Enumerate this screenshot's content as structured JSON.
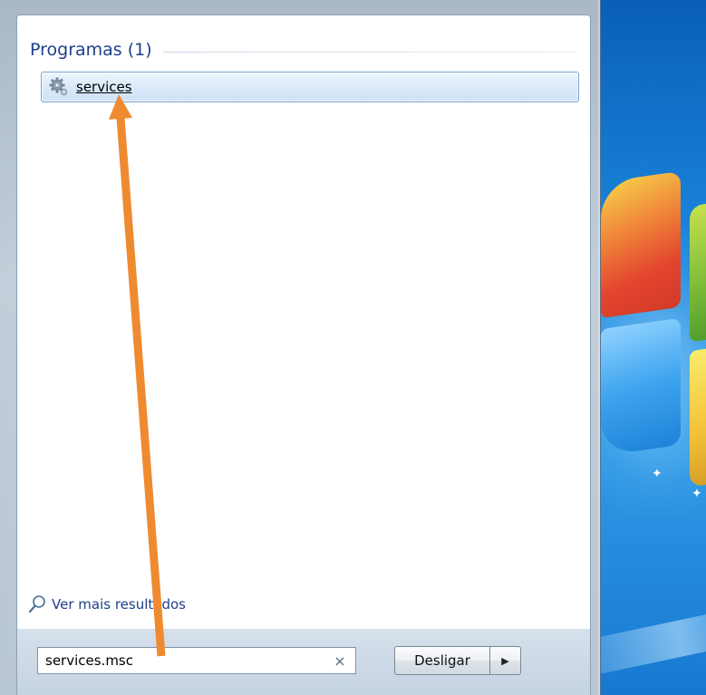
{
  "start_menu": {
    "group": {
      "title": "Programas (1)"
    },
    "results": [
      {
        "label": "services",
        "icon": "services-gear-icon"
      }
    ],
    "more_results": {
      "label": "Ver mais resultados",
      "icon": "magnifier-icon"
    },
    "search": {
      "value": "services.msc",
      "clear_icon": "×"
    },
    "shutdown": {
      "label": "Desligar",
      "arrow": "▶"
    }
  },
  "annotation": {
    "color": "#f08a30",
    "icon": "arrow-up"
  },
  "colors": {
    "group_title": "#1e3f8a",
    "selected_item_border": "#7da2ce"
  }
}
